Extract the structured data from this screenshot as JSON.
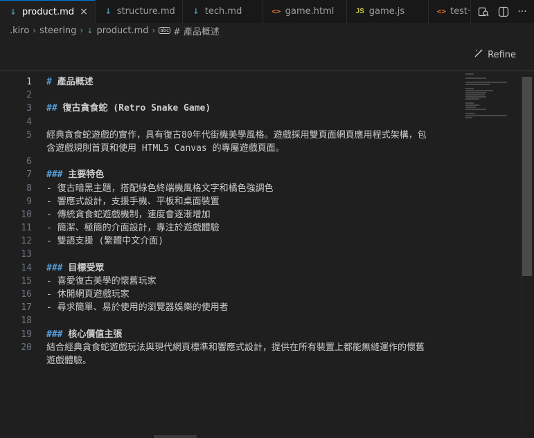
{
  "tabs": [
    {
      "label": "product.md",
      "icon": "markdown-icon",
      "active": true
    },
    {
      "label": "structure.md",
      "icon": "markdown-icon",
      "active": false
    },
    {
      "label": "tech.md",
      "icon": "markdown-icon",
      "active": false
    },
    {
      "label": "game.html",
      "icon": "html-icon",
      "active": false
    },
    {
      "label": "game.js",
      "icon": "js-icon",
      "active": false
    },
    {
      "label": "test·",
      "icon": "html-icon",
      "active": false
    }
  ],
  "icon_glyphs": {
    "markdown": "↓",
    "html": "<>",
    "js": "JS",
    "close": "×",
    "more": "···",
    "split": "◫",
    "refine": "✎"
  },
  "breadcrumb": {
    "folder": ".kiro",
    "subfolder": "steering",
    "file": "product.md",
    "symbol": "# 產品概述",
    "symbol_icon": "abc"
  },
  "refine": {
    "label": "Refine"
  },
  "editor": {
    "line_numbers": [
      "1",
      "2",
      "3",
      "4",
      "5",
      "",
      "6",
      "7",
      "8",
      "9",
      "10",
      "11",
      "12",
      "13",
      "14",
      "15",
      "16",
      "17",
      "18",
      "19",
      "20",
      ""
    ],
    "lines": [
      {
        "type": "h",
        "mark": "# ",
        "text": "產品概述"
      },
      {
        "type": "blank",
        "mark": "",
        "text": ""
      },
      {
        "type": "h",
        "mark": "## ",
        "text": "復古貪食蛇 (Retro Snake Game)"
      },
      {
        "type": "blank",
        "mark": "",
        "text": ""
      },
      {
        "type": "p",
        "mark": "",
        "text": "經典貪食蛇遊戲的實作，具有復古80年代街機美學風格。遊戲採用雙頁面網頁應用程式架構，包"
      },
      {
        "type": "p",
        "mark": "",
        "text": "含遊戲規則首頁和使用 HTML5 Canvas 的專屬遊戲頁面。"
      },
      {
        "type": "blank",
        "mark": "",
        "text": ""
      },
      {
        "type": "h",
        "mark": "### ",
        "text": "主要特色"
      },
      {
        "type": "p",
        "mark": "",
        "text": "- 復古暗黑主題，搭配綠色終端機風格文字和橘色強調色"
      },
      {
        "type": "p",
        "mark": "",
        "text": "- 響應式設計，支援手機、平板和桌面裝置"
      },
      {
        "type": "p",
        "mark": "",
        "text": "- 傳統貪食蛇遊戲機制，速度會逐漸增加"
      },
      {
        "type": "p",
        "mark": "",
        "text": "- 簡潔、極簡的介面設計，專注於遊戲體驗"
      },
      {
        "type": "p",
        "mark": "",
        "text": "- 雙語支援 (繁體中文介面)"
      },
      {
        "type": "blank",
        "mark": "",
        "text": ""
      },
      {
        "type": "h",
        "mark": "### ",
        "text": "目標受眾"
      },
      {
        "type": "p",
        "mark": "",
        "text": "- 喜愛復古美學的懷舊玩家"
      },
      {
        "type": "p",
        "mark": "",
        "text": "- 休閒網頁遊戲玩家"
      },
      {
        "type": "p",
        "mark": "",
        "text": "- 尋求簡單、易於使用的瀏覽器娛樂的使用者"
      },
      {
        "type": "blank",
        "mark": "",
        "text": ""
      },
      {
        "type": "h",
        "mark": "### ",
        "text": "核心價值主張"
      },
      {
        "type": "p",
        "mark": "",
        "text": "結合經典貪食蛇遊戲玩法與現代網頁標準和響應式設計，提供在所有裝置上都能無縫運作的懷舊"
      },
      {
        "type": "p",
        "mark": "",
        "text": "遊戲體驗。"
      }
    ]
  },
  "colors": {
    "accent": "#0078d4",
    "heading": "#569cd6",
    "markdown_icon": "#519aba",
    "html_icon": "#e37933",
    "js_icon": "#cbcb41"
  }
}
